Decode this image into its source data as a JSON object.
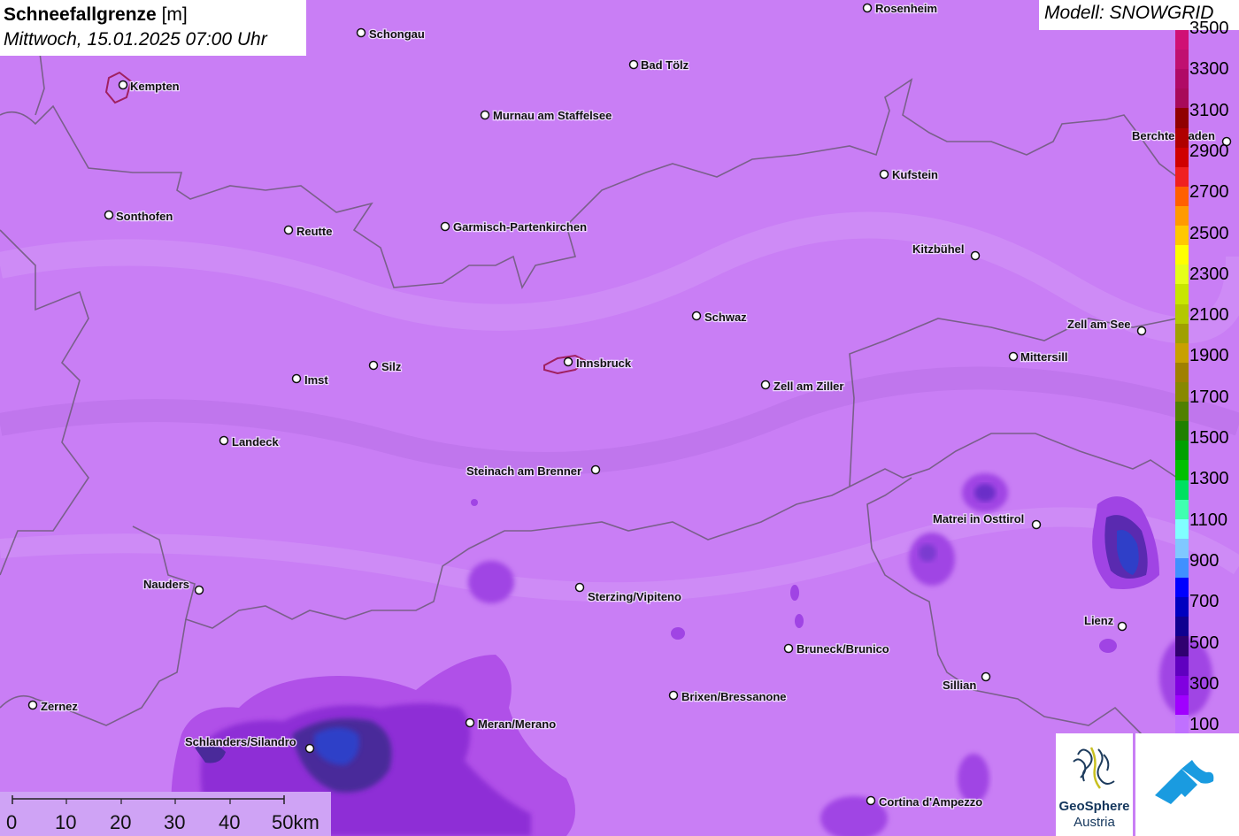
{
  "header": {
    "title_bold": "Schneefallgrenze",
    "title_unit": "[m]",
    "datetime": "Mittwoch, 15.01.2025 07:00 Uhr"
  },
  "model": {
    "label": "Modell: SNOWGRID"
  },
  "legend": {
    "labels": [
      "3500",
      "3300",
      "3100",
      "2900",
      "2700",
      "2500",
      "2300",
      "2100",
      "1900",
      "1700",
      "1500",
      "1300",
      "1100",
      "900",
      "700",
      "500",
      "300",
      "100"
    ],
    "colors": [
      "#d01075",
      "#c01070",
      "#b00a66",
      "#a80a5a",
      "#900000",
      "#b00000",
      "#d00000",
      "#f02020",
      "#ff6000",
      "#ff9a00",
      "#ffc800",
      "#ffff00",
      "#e6ff1a",
      "#c8e600",
      "#b4c800",
      "#a0a000",
      "#c8a000",
      "#a08000",
      "#888800",
      "#508000",
      "#208000",
      "#00a000",
      "#00c000",
      "#00e060",
      "#40ffb0",
      "#80ffff",
      "#80c8ff",
      "#4090ff",
      "#0000ff",
      "#0000c0",
      "#100090",
      "#300070",
      "#6000c0",
      "#8000e0",
      "#a000ff",
      "#c070ff"
    ]
  },
  "map": {
    "background_color": "#c97ef5",
    "cities": [
      {
        "name": "Rosenheim"
      },
      {
        "name": "Schongau"
      },
      {
        "name": "Bad Tölz"
      },
      {
        "name": "Kempten"
      },
      {
        "name": "Murnau am Staffelsee"
      },
      {
        "name": "Berchtesgaden"
      },
      {
        "name": "Kufstein"
      },
      {
        "name": "Sonthofen"
      },
      {
        "name": "Reutte"
      },
      {
        "name": "Garmisch-Partenkirchen"
      },
      {
        "name": "Kitzbühel"
      },
      {
        "name": "Schwaz"
      },
      {
        "name": "Zell am See"
      },
      {
        "name": "Mittersill"
      },
      {
        "name": "Silz"
      },
      {
        "name": "Innsbruck"
      },
      {
        "name": "Imst"
      },
      {
        "name": "Zell am Ziller"
      },
      {
        "name": "Landeck"
      },
      {
        "name": "Steinach am Brenner"
      },
      {
        "name": "Matrei in Osttirol"
      },
      {
        "name": "Nauders"
      },
      {
        "name": "Sterzing/Vipiteno"
      },
      {
        "name": "Lienz"
      },
      {
        "name": "Bruneck/Brunico"
      },
      {
        "name": "Sillian"
      },
      {
        "name": "Brixen/Bressanone"
      },
      {
        "name": "Zernez"
      },
      {
        "name": "Meran/Merano"
      },
      {
        "name": "Schlanders/Silandro"
      },
      {
        "name": "Cortina d'Ampezzo"
      }
    ]
  },
  "scalebar": {
    "labels": [
      "0",
      "10",
      "20",
      "30",
      "40",
      "50km"
    ]
  },
  "logos": {
    "geosphere_line1": "GeoSphere",
    "geosphere_line2": "Austria"
  }
}
